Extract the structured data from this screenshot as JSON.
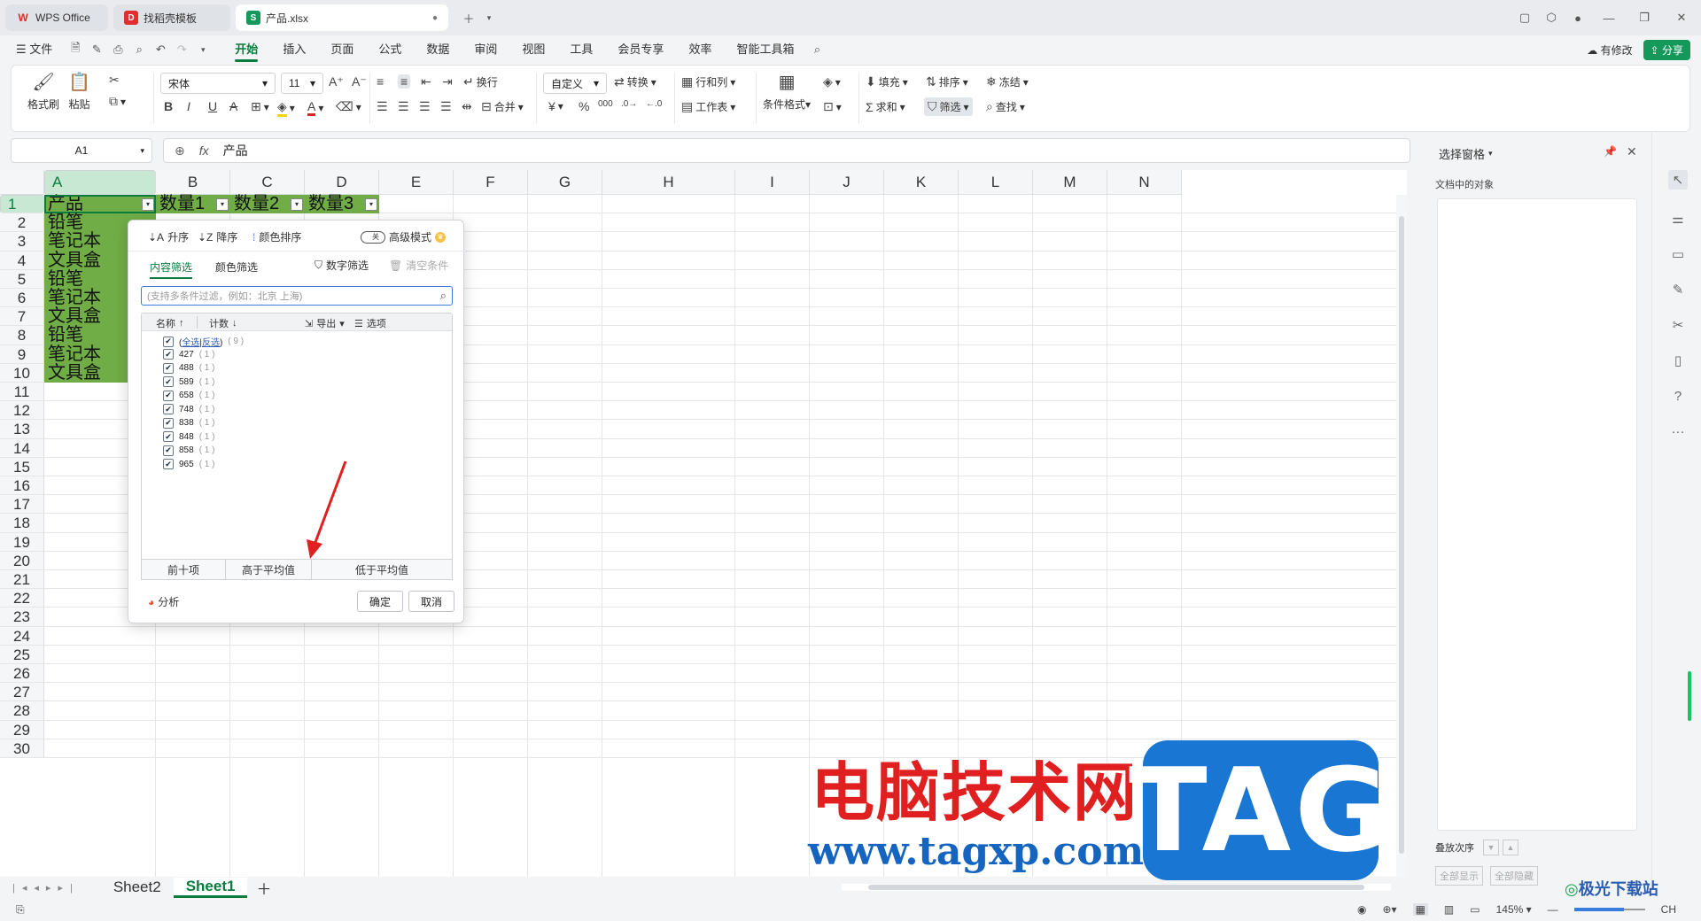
{
  "tabs": [
    {
      "label": "WPS Office",
      "icon": "wps-logo-icon",
      "color": "#e02e2e"
    },
    {
      "label": "找稻壳模板",
      "icon": "docer-icon",
      "color": "#e02e2e"
    },
    {
      "label": "产品.xlsx",
      "icon": "spreadsheet-icon",
      "color": "#14995a"
    }
  ],
  "menu": {
    "file": "文件",
    "items": [
      "开始",
      "插入",
      "页面",
      "公式",
      "数据",
      "审阅",
      "视图",
      "工具",
      "会员专享",
      "效率",
      "智能工具箱"
    ],
    "active": "开始",
    "modified": "有修改",
    "share": "分享"
  },
  "ribbon": {
    "format_painter": "格式刷",
    "paste": "粘贴",
    "font_name": "宋体",
    "font_size": "11",
    "number_format": "自定义",
    "convert": "转换",
    "wrap": "换行",
    "merge": "合并",
    "row_col": "行和列",
    "worksheet": "工作表",
    "cond_format": "条件格式",
    "fill": "填充",
    "sort": "排序",
    "freeze": "冻结",
    "sum": "求和",
    "filter": "筛选",
    "find": "查找"
  },
  "formula": {
    "cell_ref": "A1",
    "fx": "fx",
    "value": "产品"
  },
  "columns": [
    "A",
    "B",
    "C",
    "D",
    "E",
    "F",
    "G",
    "H",
    "I",
    "J",
    "K",
    "L",
    "M",
    "N"
  ],
  "rows": [
    "1",
    "2",
    "3",
    "4",
    "5",
    "6",
    "7",
    "8",
    "9",
    "10",
    "11",
    "12",
    "13",
    "14",
    "15",
    "16",
    "17",
    "18",
    "19",
    "20",
    "21",
    "22",
    "23",
    "24",
    "25",
    "26",
    "27",
    "28",
    "29",
    "30"
  ],
  "cells": {
    "headers": [
      "产品",
      "数量1",
      "数量2",
      "数量3"
    ],
    "products": [
      "铅笔",
      "笔记本",
      "文具盒",
      "铅笔",
      "笔记本",
      "文具盒",
      "铅笔",
      "笔记本",
      "文具盒"
    ]
  },
  "filter_popup": {
    "asc": "升序",
    "desc": "降序",
    "color_sort": "颜色排序",
    "toggle_state": "关",
    "advanced": "高级模式",
    "tab_content": "内容筛选",
    "tab_color": "颜色筛选",
    "number_filter": "数字筛选",
    "clear": "清空条件",
    "search_placeholder": "(支持多条件过滤，例如：北京  上海)",
    "col_name": "名称",
    "col_count": "计数",
    "export": "导出",
    "options": "选项",
    "select_all": "全选",
    "invert": "反选",
    "total": "( 9 )",
    "items": [
      {
        "value": "427",
        "count": "( 1 )"
      },
      {
        "value": "488",
        "count": "( 1 )"
      },
      {
        "value": "589",
        "count": "( 1 )"
      },
      {
        "value": "658",
        "count": "( 1 )"
      },
      {
        "value": "748",
        "count": "( 1 )"
      },
      {
        "value": "838",
        "count": "( 1 )"
      },
      {
        "value": "848",
        "count": "( 1 )"
      },
      {
        "value": "858",
        "count": "( 1 )"
      },
      {
        "value": "965",
        "count": "( 1 )"
      }
    ],
    "top10": "前十项",
    "above_avg": "高于平均值",
    "below_avg": "低于平均值",
    "analysis": "分析",
    "ok": "确定",
    "cancel": "取消"
  },
  "right_pane": {
    "title": "选择窗格",
    "subtitle": "文档中的对象",
    "stack_order": "叠放次序",
    "show_all": "全部显示",
    "hide_all": "全部隐藏"
  },
  "sheets": [
    "Sheet2",
    "Sheet1"
  ],
  "active_sheet": "Sheet1",
  "status": {
    "zoom": "145%",
    "ime": "CH"
  },
  "watermark": {
    "text": "电脑技术网",
    "url": "www.tagxp.com",
    "tag": "TAG",
    "logo": "极光下载站"
  },
  "colors": {
    "accent": "#0a7d3e",
    "cell_fill": "#70ad47",
    "arrow": "#e02020"
  }
}
